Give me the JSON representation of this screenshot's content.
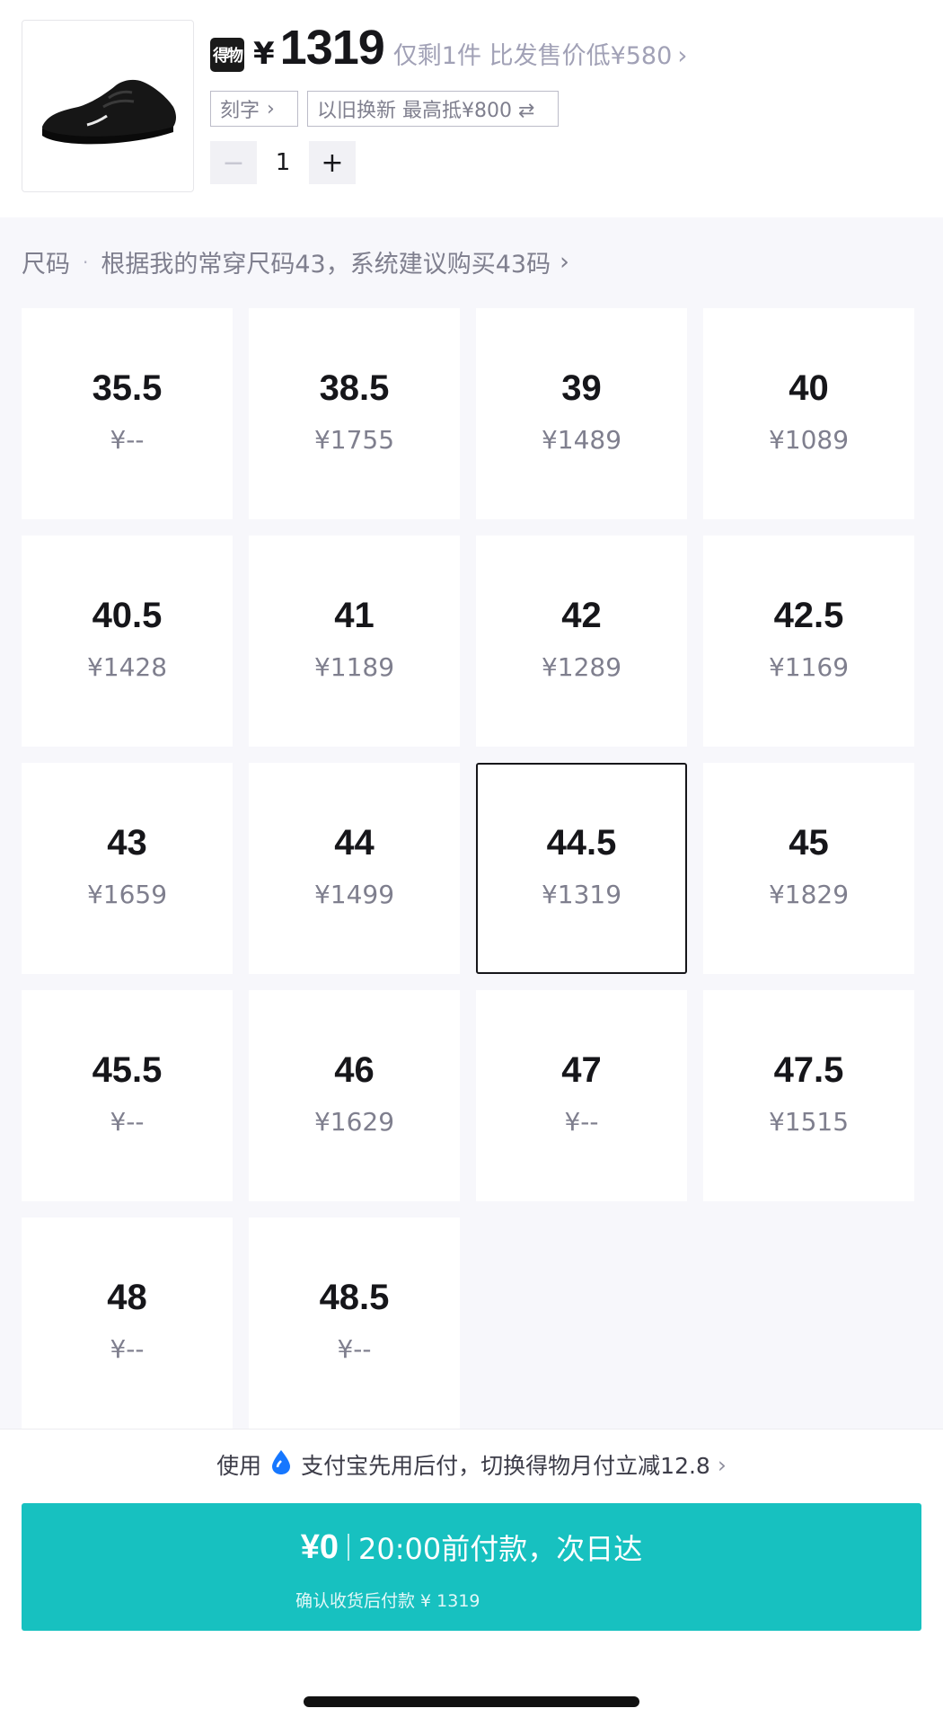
{
  "product": {
    "brand_badge": "得物",
    "currency": "¥",
    "price": "1319",
    "price_note": "仅剩1件 比发售价低¥580",
    "engrave_tag": "刻字",
    "tradein_tag": "以旧换新 最高抵¥800 ⇄",
    "quantity": "1",
    "minus_label": "−",
    "plus_label": "+"
  },
  "size_section": {
    "label": "尺码",
    "separator": "·",
    "recommendation": "根据我的常穿尺码43，系统建议购买43码"
  },
  "sizes": [
    {
      "size": "35.5",
      "price": "¥--"
    },
    {
      "size": "38.5",
      "price": "¥1755"
    },
    {
      "size": "39",
      "price": "¥1489"
    },
    {
      "size": "40",
      "price": "¥1089"
    },
    {
      "size": "40.5",
      "price": "¥1428"
    },
    {
      "size": "41",
      "price": "¥1189"
    },
    {
      "size": "42",
      "price": "¥1289"
    },
    {
      "size": "42.5",
      "price": "¥1169"
    },
    {
      "size": "43",
      "price": "¥1659"
    },
    {
      "size": "44",
      "price": "¥1499"
    },
    {
      "size": "44.5",
      "price": "¥1319",
      "selected": true
    },
    {
      "size": "45",
      "price": "¥1829"
    },
    {
      "size": "45.5",
      "price": "¥--"
    },
    {
      "size": "46",
      "price": "¥1629"
    },
    {
      "size": "47",
      "price": "¥--"
    },
    {
      "size": "47.5",
      "price": "¥1515"
    },
    {
      "size": "48",
      "price": "¥--"
    },
    {
      "size": "48.5",
      "price": "¥--"
    }
  ],
  "payment": {
    "promo_prefix": "使用",
    "promo_text": "支付宝先用后付，切换得物月付立减12.8",
    "buy_amount": "¥0",
    "buy_text": "20:00前付款，次日达",
    "buy_subtext": "确认收货后付款 ¥ 1319"
  },
  "colors": {
    "accent": "#17c1c0",
    "alipay_blue": "#1677ff",
    "muted_text": "#7f7f8e",
    "selected_border": "#16161a"
  },
  "icons": {
    "chevron": "chevron-right-icon",
    "alipay": "alipay-drop-icon",
    "minus": "minus-icon",
    "plus": "plus-icon"
  }
}
